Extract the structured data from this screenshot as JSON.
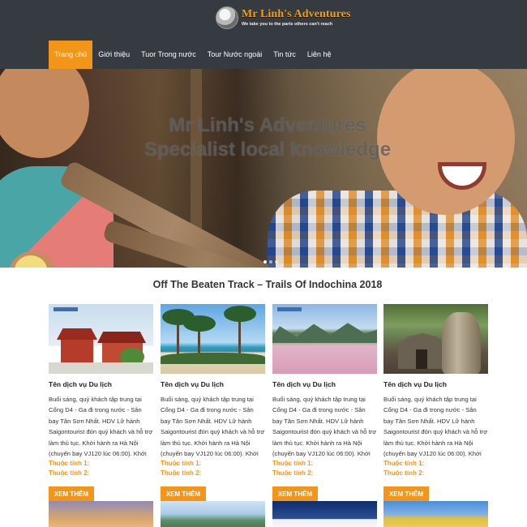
{
  "header": {
    "logo_title": "Mr Linh's Adventures",
    "logo_tagline": "We take you to the parts others can't reach"
  },
  "nav": {
    "items": [
      {
        "label": "Trang chủ",
        "active": true
      },
      {
        "label": "Giới thiệu",
        "active": false
      },
      {
        "label": "Tuor Trong nước",
        "active": false
      },
      {
        "label": "Tour Nước ngoài",
        "active": false
      },
      {
        "label": "Tin tức",
        "active": false
      },
      {
        "label": "Liên hệ",
        "active": false
      }
    ]
  },
  "hero": {
    "line1": "Mr Linh's Adventures",
    "line2": "Specialist local knowledge",
    "slide_count": 3,
    "active_slide": 1
  },
  "section": {
    "title": "Off The Beaten Track – Trails Of Indochina 2018"
  },
  "cards": [
    {
      "image": "temple",
      "title": "Tên dịch vụ Du lịch",
      "description": "Buổi sáng, quý khách tập trung tại Cổng D4 - Ga đi trong nước - Sân bay Tân Sơn Nhất. HDV Lữ hành Saigontourist đón quý khách và hỗ trợ làm thủ tục. Khởi hành ra Hà Nội (chuyến bay VJ120 lúc 06:00). Khởi",
      "attr1": "Thuộc tính 1:",
      "attr2": "Thuộc tính 2:",
      "button": "XEM THÊM"
    },
    {
      "image": "beach",
      "title": "Tên dịch vụ Du lịch",
      "description": "Buổi sáng, quý khách tập trung tại Cổng D4 - Ga đi trong nước - Sân bay Tân Sơn Nhất. HDV Lữ hành Saigontourist đón quý khách và hỗ trợ làm thủ tục. Khởi hành ra Hà Nội (chuyến bay VJ120 lúc 06:00). Khởi",
      "attr1": "Thuộc tính 1:",
      "attr2": "Thuộc tính 2:",
      "button": "XEM THÊM"
    },
    {
      "image": "field",
      "title": "Tên dịch vụ Du lịch",
      "description": "Buổi sáng, quý khách tập trung tại Cổng D4 - Ga đi trong nước - Sân bay Tân Sơn Nhất. HDV Lữ hành Saigontourist đón quý khách và hỗ trợ làm thủ tục. Khởi hành ra Hà Nội (chuyến bay VJ120 lúc 06:00). Khởi",
      "attr1": "Thuộc tính 1:",
      "attr2": "Thuộc tính 2:",
      "button": "XEM THÊM"
    },
    {
      "image": "ruins",
      "title": "Tên dịch vụ Du lịch",
      "description": "Buổi sáng, quý khách tập trung tại Cổng D4 - Ga đi trong nước - Sân bay Tân Sơn Nhất. HDV Lữ hành Saigontourist đón quý khách và hỗ trợ làm thủ tục. Khởi hành ra Hà Nội (chuyến bay VJ120 lúc 06:00). Khởi",
      "attr1": "Thuộc tính 1:",
      "attr2": "Thuộc tính 2:",
      "button": "XEM THÊM"
    }
  ],
  "colors": {
    "header_bg": "#363a41",
    "accent": "#f39519",
    "logo_gold": "#f0a018"
  }
}
